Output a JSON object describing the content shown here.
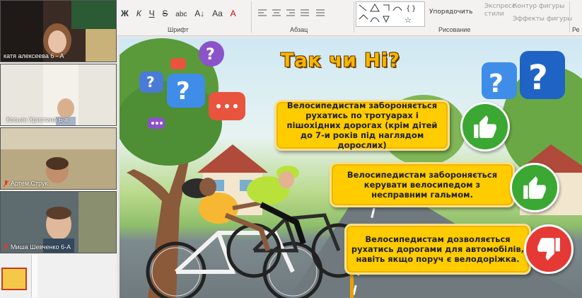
{
  "participants": [
    {
      "name": "катя алексеева 6 - А"
    },
    {
      "name": "Косьян Христина 6-а"
    },
    {
      "name": "Артем Струк"
    },
    {
      "name": "Миша Шевченко 6-А"
    }
  ],
  "ribbon": {
    "font_buttons": [
      "Ж",
      "К",
      "Ч",
      "S",
      "abc",
      "A↓",
      "Aa",
      "A"
    ],
    "groups": {
      "font": "Шрифт",
      "paragraph": "Абзац",
      "drawing": "Рисование",
      "edge": "Ре"
    },
    "arrange_label": "Упорядочить",
    "express_styles_label": "Экспресс-стили",
    "shape_outline_label": "Контур фигуры",
    "shape_effects_label": "Эффекты фигуры"
  },
  "slide": {
    "title": "Так чи Ні?",
    "statements": [
      {
        "text": "Велосипедистам забороняється рухатись по тротуарах і пішохідних дорогах (крім дітей до 7-и років під наглядом дорослих)",
        "answer": "thumbs-up-icon",
        "color": "#3aa832"
      },
      {
        "text": "Велосипедистам забороняється керувати велосипедом з несправним гальмом.",
        "answer": "thumbs-up-icon",
        "color": "#3aa832"
      },
      {
        "text": "Велосипедистам дозволяється рухатись дорогами для автомобілів, навіть якщо поруч є велодоріжка.",
        "answer": "thumbs-down-icon",
        "color": "#e53935"
      }
    ]
  },
  "colors": {
    "title": "#f7b700",
    "statement_bg": "#ffcc00",
    "accent_selected": "#c43e1c"
  }
}
